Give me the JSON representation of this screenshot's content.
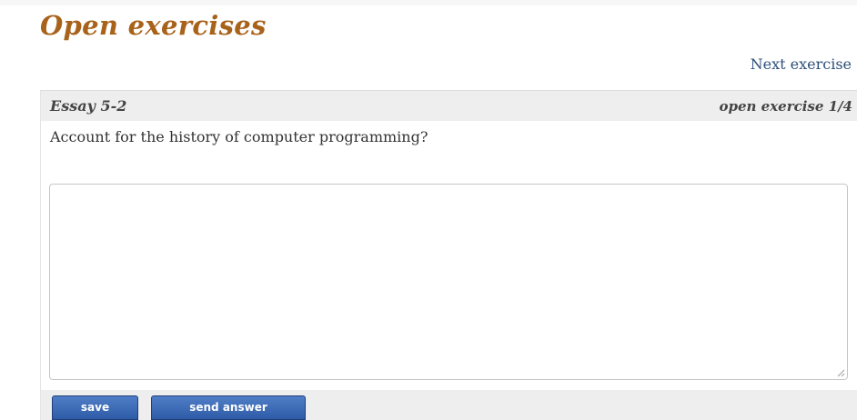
{
  "page": {
    "title": "Open exercises",
    "next_link": "Next exercise"
  },
  "exercise": {
    "name": "Essay 5-2",
    "counter": "open exercise 1/4",
    "question": "Account for the history of computer programming?",
    "answer_value": ""
  },
  "buttons": {
    "save_label": "save",
    "send_label": "send answer"
  },
  "colors": {
    "title": "#a8621a",
    "link": "#2d4f7a",
    "header_bg": "#eeeeee",
    "button_bg": "#3a67b3"
  },
  "icons": {
    "resize_grip": "resize-grip-icon"
  }
}
